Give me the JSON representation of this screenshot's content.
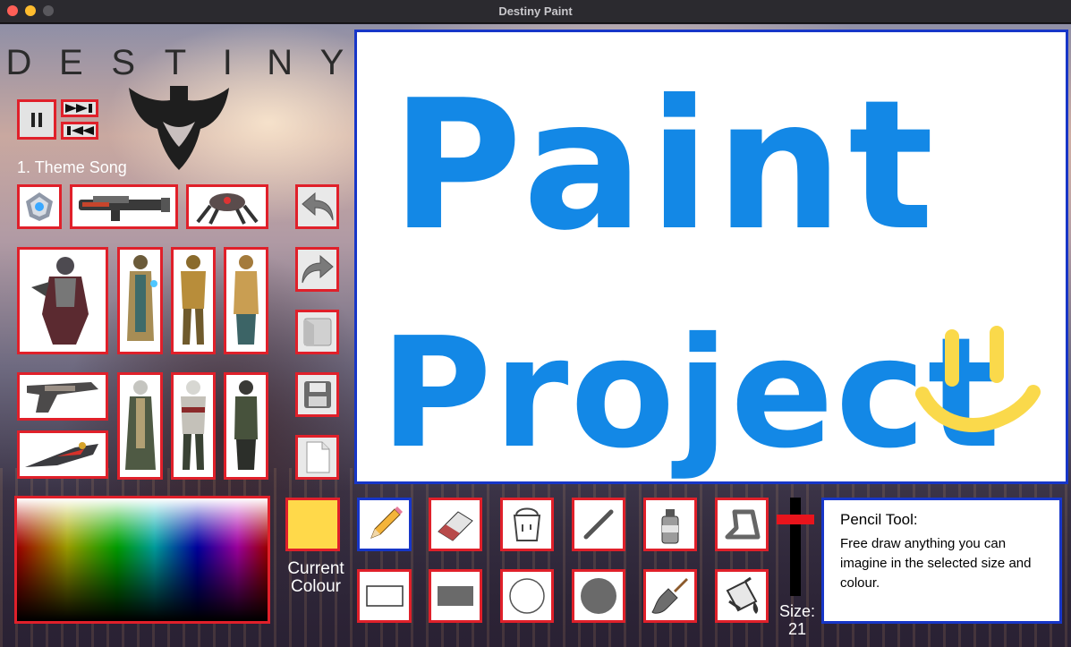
{
  "window": {
    "title": "Destiny Paint"
  },
  "logo": {
    "text": "DESTINY"
  },
  "music": {
    "song": "1. Theme Song",
    "pause_icon": "pause-icon",
    "next_icon": "skip-forward-icon",
    "prev_icon": "skip-back-icon"
  },
  "stamps": [
    "ghost-stamp",
    "rocket-launcher-stamp",
    "spider-tank-stamp",
    "hunter-armor-stamp",
    "warlock-armor-stamp",
    "titan-armor-stamp",
    "warlock-gold-stamp",
    "hand-cannon-stamp",
    "warlock-robe-stamp",
    "titan-green-stamp",
    "hunter-green-stamp",
    "sparrow-stamp"
  ],
  "side_actions": [
    "undo-icon",
    "redo-icon",
    "open-icon",
    "save-icon",
    "new-file-icon"
  ],
  "canvas": {
    "line1": "Paint",
    "line2": "Project",
    "text_color": "#1388e6",
    "smiley_color": "#fad94b"
  },
  "colour": {
    "current": "#ffd94a",
    "label": "Current Colour"
  },
  "tools_row1": [
    "pencil-icon",
    "eraser-icon",
    "paint-bucket-icon",
    "line-icon",
    "spray-can-icon",
    "polygon-icon"
  ],
  "tools_row2": [
    "rectangle-outline-icon",
    "rectangle-filled-icon",
    "ellipse-outline-icon",
    "ellipse-filled-icon",
    "brush-icon",
    "fill-paint-icon"
  ],
  "selected_tool": "pencil-icon",
  "size": {
    "label": "Size:",
    "value": "21",
    "level": 21
  },
  "info": {
    "title": "Pencil Tool:",
    "description": "Free draw anything you can imagine in the selected size and colour."
  },
  "accent": {
    "frame": "#e0202a",
    "selected": "#1736c8"
  }
}
